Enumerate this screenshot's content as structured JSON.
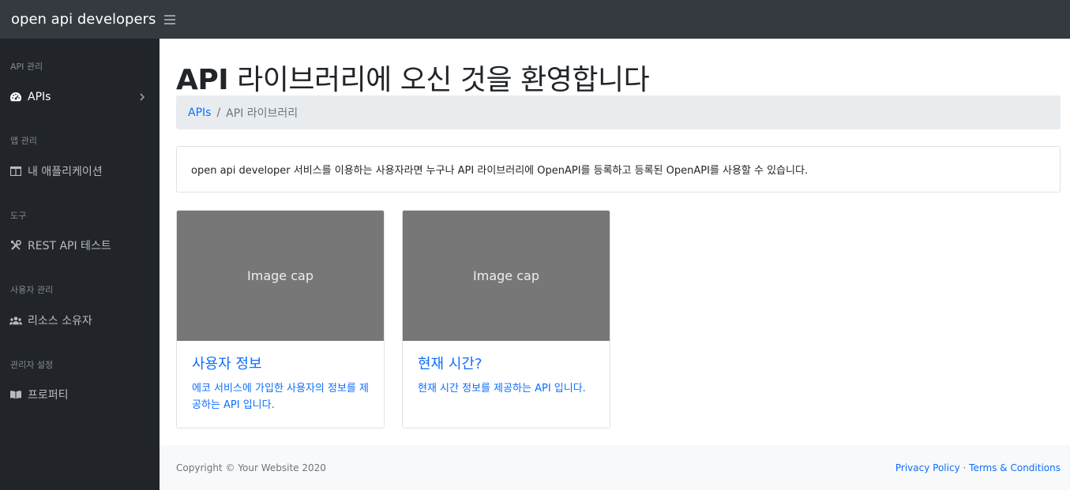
{
  "app": {
    "brand": "open api developers"
  },
  "sidebar": {
    "sections": [
      {
        "heading": "API 관리",
        "item": {
          "label": "APIs",
          "icon": "tachometer-icon"
        }
      },
      {
        "heading": "앱 관리",
        "item": {
          "label": "내 애플리케이션",
          "icon": "columns-icon"
        }
      },
      {
        "heading": "도구",
        "item": {
          "label": "REST API 테스트",
          "icon": "tools-icon"
        }
      },
      {
        "heading": "사용자 관리",
        "item": {
          "label": "리소스 소유자",
          "icon": "users-icon"
        }
      },
      {
        "heading": "관리자 설정",
        "item": {
          "label": "프로퍼티",
          "icon": "book-icon"
        }
      }
    ]
  },
  "main": {
    "title_bold": "API",
    "title_rest": " 라이브러리에 오신 것을 환영합니다",
    "breadcrumb": {
      "link": "APIs",
      "separator": "/",
      "current": "API 라이브러리"
    },
    "info_text": "open api developer 서비스를 이용하는 사용자라면 누구나 API 라이브러리에 OpenAPI를 등록하고 등록된 OpenAPI를 사용할 수 있습니다.",
    "cards": [
      {
        "image_cap": "Image cap",
        "title": "사용자 정보",
        "text": "에코 서비스에 가입한 사용자의 정보를 제공하는 API 입니다."
      },
      {
        "image_cap": "Image cap",
        "title": "현재 시간?",
        "text": "현재 시간 정보를 제공하는 API 입니다."
      }
    ]
  },
  "footer": {
    "copyright": "Copyright © Your Website 2020",
    "privacy": "Privacy Policy",
    "dot": "·",
    "terms": "Terms & Conditions"
  },
  "colors": {
    "topbar": "#343a40",
    "sidebar": "#212529",
    "accent": "#0d6efd",
    "image_cap_bg": "#777777"
  }
}
